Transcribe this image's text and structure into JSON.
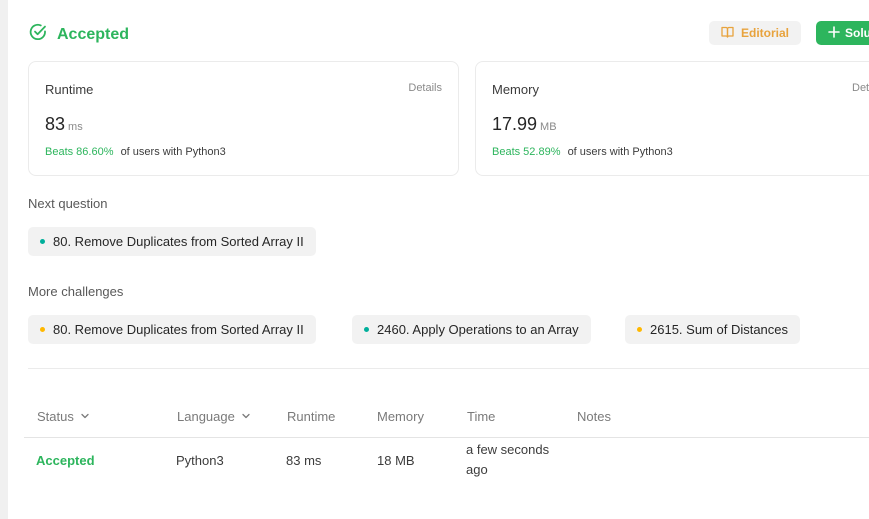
{
  "header": {
    "status": "Accepted",
    "editorial_label": "Editorial",
    "solution_label": "Solution"
  },
  "runtime_card": {
    "label": "Runtime",
    "details": "Details",
    "value": "83",
    "unit": "ms",
    "beats": "Beats 86.60%",
    "beats_suffix": "of users with Python3"
  },
  "memory_card": {
    "label": "Memory",
    "details": "Details",
    "value": "17.99",
    "unit": "MB",
    "beats": "Beats 52.89%",
    "beats_suffix": "of users with Python3"
  },
  "next_question": {
    "label": "Next question",
    "items": [
      {
        "title": "80. Remove Duplicates from Sorted Array II",
        "difficulty_color": "#00af9b"
      }
    ]
  },
  "more_challenges": {
    "label": "More challenges",
    "items": [
      {
        "title": "80. Remove Duplicates from Sorted Array II",
        "difficulty_color": "#ffb800"
      },
      {
        "title": "2460. Apply Operations to an Array",
        "difficulty_color": "#00af9b"
      },
      {
        "title": "2615. Sum of Distances",
        "difficulty_color": "#ffb800"
      }
    ]
  },
  "table": {
    "headers": [
      "Status",
      "Language",
      "Runtime",
      "Memory",
      "Time",
      "Notes"
    ],
    "rows": [
      {
        "status": "Accepted",
        "language": "Python3",
        "runtime": "83 ms",
        "memory": "18 MB",
        "time": "a few seconds ago",
        "notes": ""
      }
    ]
  },
  "colors": {
    "accent_green": "#2db55d",
    "editorial_orange": "#e8a33d"
  }
}
